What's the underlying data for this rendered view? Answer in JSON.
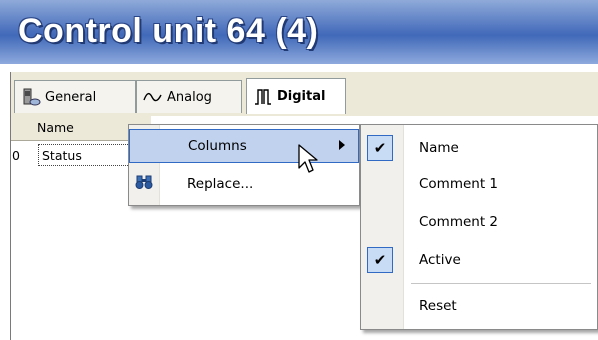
{
  "window": {
    "title": "Control unit 64 (4)"
  },
  "tabs": [
    {
      "label": "General",
      "icon": "device-icon"
    },
    {
      "label": "Analog",
      "icon": "analog-wave-icon"
    },
    {
      "label": "Digital",
      "icon": "digital-signal-icon",
      "selected": true
    }
  ],
  "grid": {
    "columns": [
      "Name"
    ],
    "rows": [
      {
        "index": "0",
        "name": "Status"
      }
    ]
  },
  "context_menu": {
    "items": [
      {
        "label": "Columns",
        "has_submenu": true,
        "highlighted": true
      },
      {
        "label": "Replace...",
        "icon": "binoculars-icon"
      }
    ]
  },
  "columns_submenu": {
    "items": [
      {
        "label": "Name",
        "checked": true
      },
      {
        "label": "Comment 1",
        "checked": false
      },
      {
        "label": "Comment 2",
        "checked": false
      },
      {
        "label": "Active",
        "checked": true
      },
      {
        "label": "Reset"
      }
    ]
  },
  "colors": {
    "title_bar": "#4f74bf",
    "menu_highlight": "#c1d2ee",
    "menu_highlight_border": "#316ac5"
  }
}
